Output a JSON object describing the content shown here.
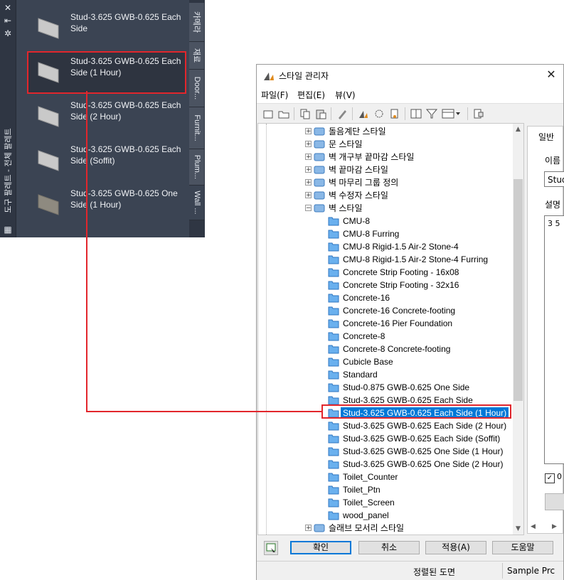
{
  "palette": {
    "title": "도구 팔레트 - 전체 팔레트",
    "tools": [
      {
        "label": "Stud-3.625 GWB-0.625 Each Side",
        "selected": false
      },
      {
        "label": "Stud-3.625 GWB-0.625 Each Side (1 Hour)",
        "selected": true
      },
      {
        "label": "Stud-3.625 GWB-0.625 Each Side (2 Hour)",
        "selected": false
      },
      {
        "label": "Stud-3.625 GWB-0.625 Each Side (Soffit)",
        "selected": false
      },
      {
        "label": "Stud-3.625 GWB-0.625 One Side (1 Hour)",
        "selected": false
      }
    ],
    "tabs": [
      {
        "label": "카메라"
      },
      {
        "label": "재료"
      },
      {
        "label": "Door..."
      },
      {
        "label": "Furnit..."
      },
      {
        "label": "Plum..."
      },
      {
        "label": "Wall ..."
      }
    ]
  },
  "window": {
    "title": "스타일 관리자",
    "menus": [
      "파일(F)",
      "편집(E)",
      "뷰(V)"
    ],
    "tree": {
      "categories": [
        {
          "label": "돌음계단 스타일",
          "expanded": false
        },
        {
          "label": "문 스타일",
          "expanded": false
        },
        {
          "label": "벽 개구부 끝마감 스타일",
          "expanded": false
        },
        {
          "label": "벽 끝마감 스타일",
          "expanded": false
        },
        {
          "label": "벽 마무리 그룹 정의",
          "expanded": false
        },
        {
          "label": "벽 수정자 스타일",
          "expanded": false
        },
        {
          "label": "벽 스타일",
          "expanded": true
        }
      ],
      "wall_styles": [
        "CMU-8",
        "CMU-8 Furring",
        "CMU-8 Rigid-1.5 Air-2 Stone-4",
        "CMU-8 Rigid-1.5 Air-2 Stone-4 Furring",
        "Concrete Strip Footing - 16x08",
        "Concrete Strip Footing - 32x16",
        "Concrete-16",
        "Concrete-16 Concrete-footing",
        "Concrete-16 Pier Foundation",
        "Concrete-8",
        "Concrete-8 Concrete-footing",
        "Cubicle Base",
        "Standard",
        "Stud-0.875 GWB-0.625 One Side",
        "Stud-3.625 GWB-0.625 Each Side",
        "Stud-3.625 GWB-0.625 Each Side (1 Hour)",
        "Stud-3.625 GWB-0.625 Each Side (2 Hour)",
        "Stud-3.625 GWB-0.625 Each Side (Soffit)",
        "Stud-3.625 GWB-0.625 One Side (1 Hour)",
        "Stud-3.625 GWB-0.625 One Side (2 Hour)",
        "Toilet_Counter",
        "Toilet_Ptn",
        "Toilet_Screen",
        "wood_panel"
      ],
      "selected_index": 15,
      "trailing_category": "슬래브 모서리 스타일"
    },
    "panel": {
      "tab": "일반",
      "name_label": "이름",
      "name_value": "Stud",
      "desc_label": "설명",
      "desc_value": "3 5",
      "checkbox_checked": true,
      "checkbox_label": "0"
    },
    "buttons": {
      "ok": "확인",
      "cancel": "취소",
      "apply": "적용(A)",
      "help": "도움말"
    },
    "status": {
      "left": "정렬된 도면",
      "right": "Sample Prc"
    }
  },
  "colors": {
    "palette_bg": "#3b4453",
    "highlight_red": "#e2262c",
    "selection_blue": "#0078d7"
  }
}
